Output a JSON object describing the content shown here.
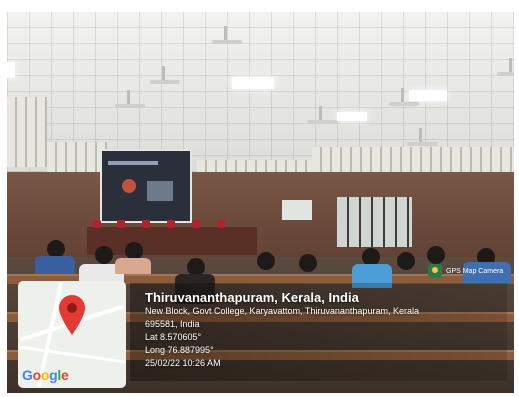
{
  "photo": {
    "subject": "auditorium seminar with projected video call"
  },
  "map_card": {
    "logo_text": "Google",
    "logo_colors": [
      "#4285F4",
      "#EA4335",
      "#FBBC05",
      "#4285F4",
      "#34A853",
      "#EA4335"
    ],
    "pin_color": "#E53935"
  },
  "location": {
    "city": "Thiruvananthapuram, Kerala, India",
    "address_line1": "New Block, Govt College, Karyavattom, Thiruvananthapuram, Kerala",
    "address_line2": "695581, India",
    "lat": "Lat 8.570605°",
    "long": "Long 76.887995°",
    "timestamp": "25/02/22 10:26 AM"
  },
  "watermark": {
    "label": "GPS Map Camera",
    "icon": "gps-map-camera-icon"
  }
}
